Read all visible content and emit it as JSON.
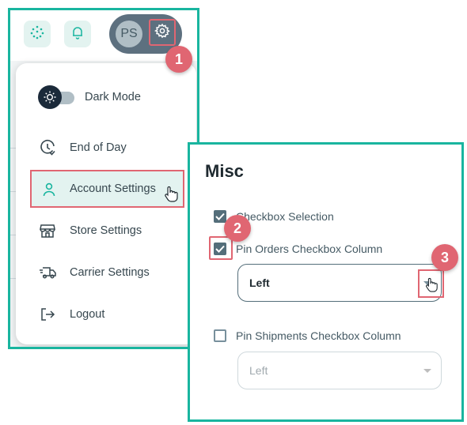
{
  "topbar": {
    "avatar_initials": "PS",
    "icons": [
      "apps-icon",
      "bell-icon",
      "gear-icon"
    ]
  },
  "menu": {
    "dark_mode_label": "Dark Mode",
    "dark_mode_on": false,
    "items": [
      {
        "label": "End of Day",
        "icon": "clock-check-icon"
      },
      {
        "label": "Account Settings",
        "icon": "person-icon",
        "active": true
      },
      {
        "label": "Store Settings",
        "icon": "store-icon"
      },
      {
        "label": "Carrier Settings",
        "icon": "truck-icon"
      },
      {
        "label": "Logout",
        "icon": "logout-icon"
      }
    ]
  },
  "misc": {
    "title": "Misc",
    "checkbox_selection": {
      "label": "Checkbox Selection",
      "checked": true
    },
    "pin_orders": {
      "label": "Pin Orders Checkbox Column",
      "checked": true,
      "value": "Left"
    },
    "pin_shipments": {
      "label": "Pin Shipments Checkbox Column",
      "checked": false,
      "value": "Left",
      "disabled": true
    }
  },
  "badges": [
    "1",
    "2",
    "3"
  ],
  "colors": {
    "accent": "#19b59f",
    "highlight": "#e06672",
    "active_bg": "#e3f3f0",
    "checkbox": "#546e7a"
  }
}
